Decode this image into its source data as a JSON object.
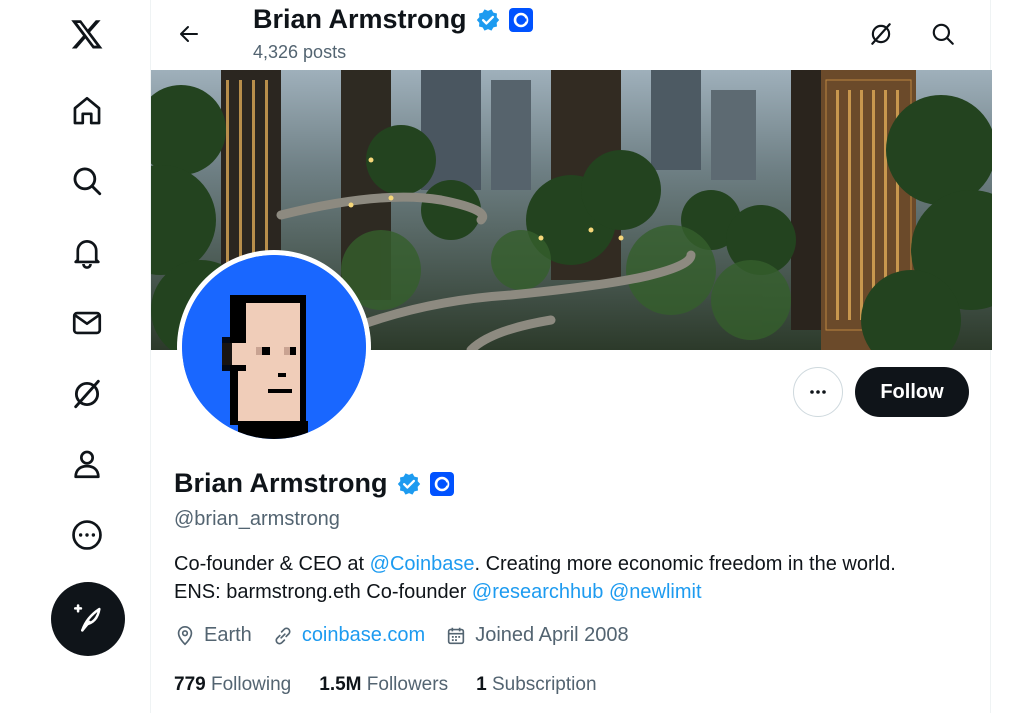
{
  "header": {
    "name": "Brian Armstrong",
    "posts_count": "4,326 posts"
  },
  "profile": {
    "name": "Brian Armstrong",
    "handle": "@brian_armstrong",
    "bio": {
      "line1_prefix": "Co-founder & CEO at ",
      "mention_coinbase": "@Coinbase",
      "line1_suffix": ". Creating more economic freedom in the world.",
      "line2_prefix": "ENS: barmstrong.eth Co-founder ",
      "mention_researchhub": "@researchhub",
      "mention_newlimit": "@newlimit"
    },
    "location": "Earth",
    "website": "coinbase.com",
    "joined": "Joined April 2008",
    "follow_label": "Follow",
    "more_label": "···"
  },
  "stats": {
    "following_count": "779",
    "following_label": "Following",
    "followers_count": "1.5M",
    "followers_label": "Followers",
    "subscription_count": "1",
    "subscription_label": "Subscription"
  },
  "nav": {
    "items": [
      "x-logo-icon",
      "home-icon",
      "search-icon",
      "notifications-icon",
      "messages-icon",
      "grok-icon",
      "profile-icon",
      "more-icon"
    ],
    "post_icon": "compose-icon"
  },
  "colors": {
    "accent": "#1d9bf0",
    "verified": "#1d9bf0",
    "coinbase_blue": "#0052ff",
    "avatar_bg": "#1967ff",
    "text_primary": "#0f1419",
    "text_secondary": "#536471"
  }
}
